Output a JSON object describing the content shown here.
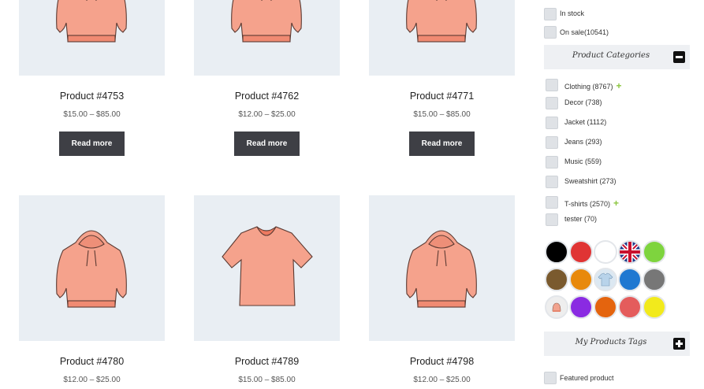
{
  "products": [
    {
      "title": "Product #4753",
      "price": "$15.00 – $85.00",
      "button": "Read more",
      "shirt": "hoodie"
    },
    {
      "title": "Product #4762",
      "price": "$12.00 – $25.00",
      "button": "Read more",
      "shirt": "hoodie"
    },
    {
      "title": "Product #4771",
      "price": "$15.00 – $85.00",
      "button": "Read more",
      "shirt": "hoodie"
    },
    {
      "title": "Product #4780",
      "price": "$12.00 – $25.00",
      "shirt": "hoodie"
    },
    {
      "title": "Product #4789",
      "price": "$15.00 – $85.00",
      "shirt": "v-neck-tshirt"
    },
    {
      "title": "Product #4798",
      "price": "$12.00 – $25.00",
      "shirt": "hoodie"
    }
  ],
  "filters": {
    "in_stock": "In stock",
    "on_sale": "On sale(10541)"
  },
  "categories_panel": {
    "title": "Product Categories",
    "toggle_icon": "minus-icon",
    "items": [
      {
        "label": "Clothing (8767)",
        "expandable": true
      },
      {
        "label": "Decor (738)"
      },
      {
        "label": "Jacket (1112)"
      },
      {
        "label": "Jeans (293)"
      },
      {
        "label": "Music (559)"
      },
      {
        "label": "Sweatshirt (273)"
      },
      {
        "label": "T-shirts (2570)",
        "expandable": true
      },
      {
        "label": "tester (70)"
      }
    ],
    "expand_symbol": "+"
  },
  "color_swatches": [
    {
      "name": "black",
      "color": "#000000"
    },
    {
      "name": "red",
      "color": "#e03434"
    },
    {
      "name": "white",
      "color": "#ffffff"
    },
    {
      "name": "union-jack-flag",
      "color": "#1f3a8a"
    },
    {
      "name": "green",
      "color": "#7ed43e"
    },
    {
      "name": "brown",
      "color": "#7a5a2e"
    },
    {
      "name": "orange",
      "color": "#e8890c"
    },
    {
      "name": "shirt-image",
      "color": "#dce8f2"
    },
    {
      "name": "blue",
      "color": "#1f78d1"
    },
    {
      "name": "gray",
      "color": "#777777"
    },
    {
      "name": "hat-image",
      "color": "#eeeeee"
    },
    {
      "name": "purple",
      "color": "#8a2be2"
    },
    {
      "name": "dark-orange",
      "color": "#e4640e"
    },
    {
      "name": "coral",
      "color": "#e45c5c"
    },
    {
      "name": "yellow",
      "color": "#f2ea1c"
    }
  ],
  "tags_panel": {
    "title": "My Products Tags",
    "toggle_icon": "plus-icon",
    "items": [
      {
        "label": "Featured product"
      }
    ]
  }
}
